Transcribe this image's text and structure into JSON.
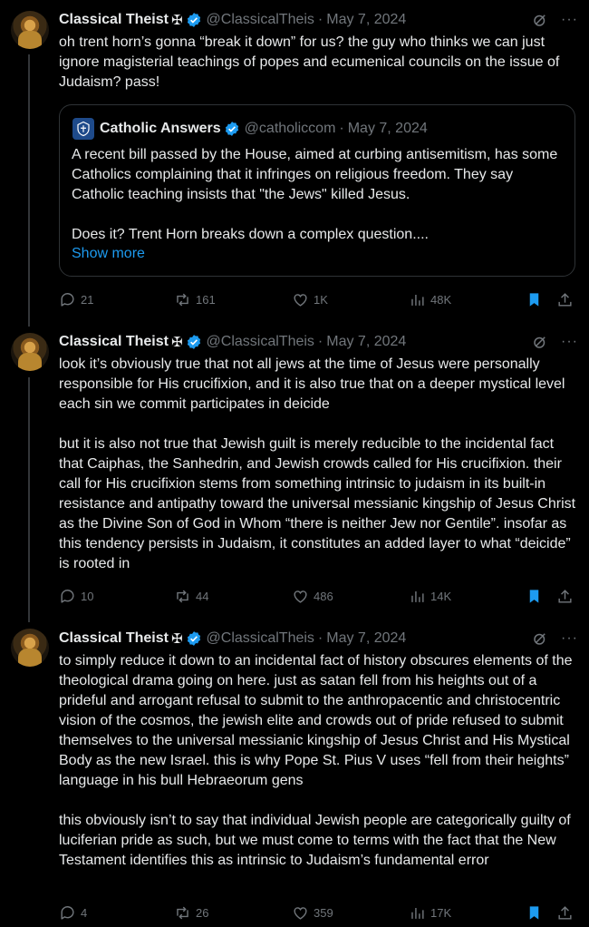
{
  "tweets": [
    {
      "author": "Classical Theist",
      "cross": "✠",
      "handle": "@ClassicalTheis",
      "dot": "·",
      "date": "May 7, 2024",
      "text": "oh trent horn’s gonna “break it down” for us? the guy who thinks we can just ignore magisterial teachings of popes and ecumenical councils on the issue of Judaism? pass!",
      "quote": {
        "author": "Catholic Answers",
        "handle": "@catholiccom",
        "dot": "·",
        "date": "May 7, 2024",
        "text": "A recent bill passed by the House, aimed at curbing antisemitism, has some Catholics complaining that it infringes on religious freedom. They say Catholic teaching insists that \"the Jews\" killed Jesus.\n\nDoes it? Trent Horn breaks down a complex question....",
        "show_more": "Show more"
      },
      "replies": "21",
      "reposts": "161",
      "likes": "1K",
      "views": "48K"
    },
    {
      "author": "Classical Theist",
      "cross": "✠",
      "handle": "@ClassicalTheis",
      "dot": "·",
      "date": "May 7, 2024",
      "text": "look it’s obviously true that not all jews at the time of Jesus were personally responsible for His crucifixion, and it is also true that on a deeper mystical level each sin we commit participates in deicide\n\nbut it is also not true that Jewish guilt is merely reducible to the incidental fact that Caiphas, the Sanhedrin, and Jewish crowds called for His crucifixion. their call for His crucifixion stems from something intrinsic to judaism in its built-in resistance and antipathy toward the universal messianic kingship of Jesus Christ as the Divine Son of God in Whom “there is neither Jew nor Gentile”. insofar as this tendency persists in Judaism, it constitutes an added layer to what “deicide” is rooted in",
      "replies": "10",
      "reposts": "44",
      "likes": "486",
      "views": "14K"
    },
    {
      "author": "Classical Theist",
      "cross": "✠",
      "handle": "@ClassicalTheis",
      "dot": "·",
      "date": "May 7, 2024",
      "text": "to simply reduce it down to an incidental fact of history obscures elements of the theological drama going on here. just as satan fell from his heights out of a prideful and arrogant refusal to submit to the anthropacentic and christocentric vision of the cosmos, the jewish elite and crowds out of pride refused to submit themselves to the universal messianic kingship of Jesus Christ and His Mystical Body as the new Israel. this is why Pope St. Pius V uses “fell from their heights” language in his bull Hebraeorum gens\n\nthis obviously isn’t to say that individual Jewish people are categorically guilty of luciferian pride as such, but we must come to terms with the fact that the New Testament identifies this as intrinsic to Judaism’s fundamental error",
      "replies": "4",
      "reposts": "26",
      "likes": "359",
      "views": "17K"
    }
  ],
  "colors": {
    "background": "#000000",
    "text": "#e7e9ea",
    "muted": "#71767b",
    "accent": "#1d9bf0",
    "border": "#2f3336"
  },
  "icons": [
    "verified-badge-icon",
    "grok-icon",
    "more-icon",
    "reply-icon",
    "repost-icon",
    "like-icon",
    "views-icon",
    "bookmark-icon",
    "share-icon"
  ]
}
